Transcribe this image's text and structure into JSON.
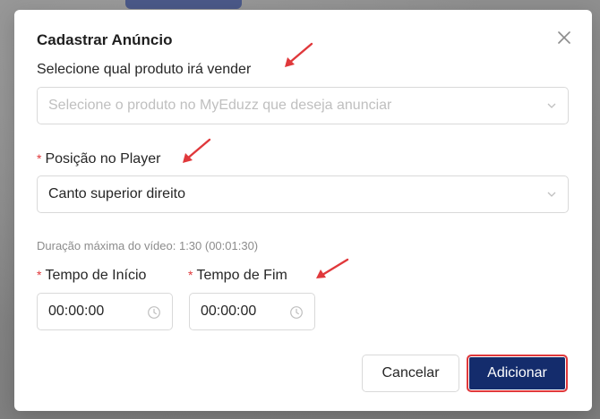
{
  "modal": {
    "title": "Cadastrar Anúncio",
    "close_icon": "close-icon"
  },
  "product": {
    "label": "Selecione qual produto irá vender",
    "placeholder": "Selecione o produto no MyEduzz que deseja anunciar",
    "value": ""
  },
  "position": {
    "required_mark": "*",
    "label": "Posição no Player",
    "value": "Canto superior direito"
  },
  "duration_hint": "Duração máxima do vídeo: 1:30 (00:01:30)",
  "start_time": {
    "required_mark": "*",
    "label": "Tempo de Início",
    "value": "00:00:00",
    "icon": "clock-icon"
  },
  "end_time": {
    "required_mark": "*",
    "label": "Tempo de Fim",
    "value": "00:00:00",
    "icon": "clock-icon"
  },
  "buttons": {
    "cancel": "Cancelar",
    "add": "Adicionar"
  },
  "colors": {
    "primary": "#142c6c",
    "required": "#e0383b",
    "annotation": "#e0383b"
  }
}
